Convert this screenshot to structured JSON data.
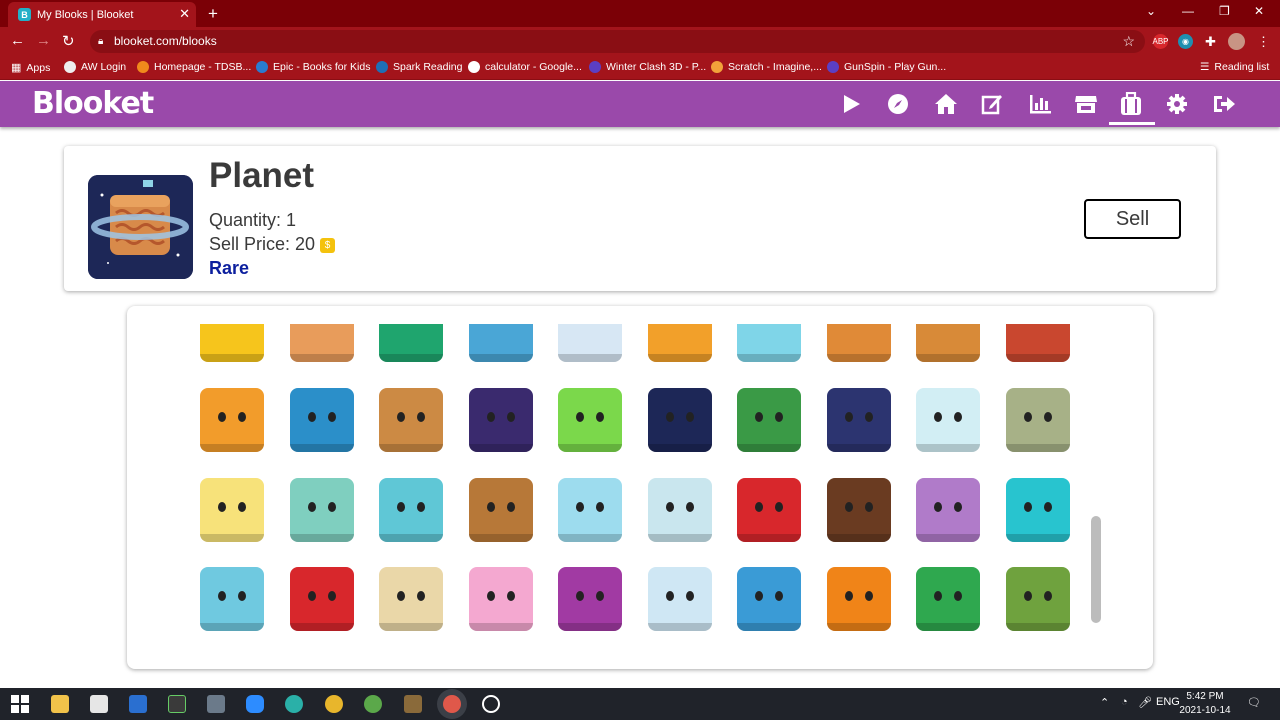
{
  "browser": {
    "tab_title": "My Blooks | Blooket",
    "tab_favicon": "B",
    "url": "blooket.com/blooks",
    "bookmarks": [
      "Apps",
      "AW Login",
      "Homepage - TDSB...",
      "Epic - Books for Kids",
      "Spark Reading",
      "calculator - Google...",
      "Winter Clash 3D - P...",
      "Scratch - Imagine,...",
      "GunSpin - Play Gun..."
    ],
    "reading_list": "Reading list"
  },
  "header": {
    "logo": "Blooket",
    "icons": [
      "play-icon",
      "compass-icon",
      "home-icon",
      "edit-icon",
      "stats-icon",
      "market-icon",
      "blooks-icon",
      "settings-icon",
      "logout-icon"
    ]
  },
  "selected_blook": {
    "name": "Planet",
    "quantity_label": "Quantity: 1",
    "sell_price_label": "Sell Price: 20",
    "rarity": "Rare",
    "sell_button": "Sell"
  },
  "blooks": [
    {
      "name": "sun-blook",
      "color": "#f6c51c"
    },
    {
      "name": "toast-blook",
      "color": "#e89c5b"
    },
    {
      "name": "sushi-blook",
      "color": "#1fa56e"
    },
    {
      "name": "strawberry-milk-blook",
      "color": "#4aa6d6"
    },
    {
      "name": "breakfast-plate-blook",
      "color": "#d7e7f4"
    },
    {
      "name": "orange-juice-blook",
      "color": "#f2a02a"
    },
    {
      "name": "cow-blook",
      "color": "#7fd5e8"
    },
    {
      "name": "waffle-blook",
      "color": "#e08a37"
    },
    {
      "name": "pancakes-blook",
      "color": "#d88a38"
    },
    {
      "name": "pie-blook",
      "color": "#c9472f"
    },
    {
      "name": "pizza-blook",
      "color": "#f29c2b"
    },
    {
      "name": "earth-blook",
      "color": "#2b8fc9"
    },
    {
      "name": "mars-blook",
      "color": "#cc8a44"
    },
    {
      "name": "stars-blook",
      "color": "#3a2a6e"
    },
    {
      "name": "alien-blook",
      "color": "#7bd84b"
    },
    {
      "name": "planet-blook",
      "color": "#1d2757"
    },
    {
      "name": "ufo-blook",
      "color": "#3a9a46"
    },
    {
      "name": "rocket-blook",
      "color": "#2c3470"
    },
    {
      "name": "astronaut-blook",
      "color": "#d2eef4"
    },
    {
      "name": "alarm-bot-blook",
      "color": "#a7b187"
    },
    {
      "name": "lovely-bot-blook",
      "color": "#f7e27a"
    },
    {
      "name": "angry-bot-blook",
      "color": "#7fcfbf"
    },
    {
      "name": "computer-bot-blook",
      "color": "#5fc7d6"
    },
    {
      "name": "wooden-bot-blook",
      "color": "#b77838"
    },
    {
      "name": "mega-bot-blook",
      "color": "#9ddcee"
    },
    {
      "name": "brain-bot-blook",
      "color": "#c9e6ee"
    },
    {
      "name": "red-bot-blook",
      "color": "#d8272c"
    },
    {
      "name": "boot-blook",
      "color": "#6a3b21"
    },
    {
      "name": "jellyfish-blook",
      "color": "#b07bc9"
    },
    {
      "name": "clownfish-blook",
      "color": "#28c4cf"
    },
    {
      "name": "frog-blook",
      "color": "#6fc9e0"
    },
    {
      "name": "crab-blook",
      "color": "#d8272c"
    },
    {
      "name": "pufferfish-blook",
      "color": "#ead7a8"
    },
    {
      "name": "blobfish-blook",
      "color": "#f4a8d0"
    },
    {
      "name": "octopus-blook",
      "color": "#a13aa3"
    },
    {
      "name": "narwhal-blook",
      "color": "#cfe7f4"
    },
    {
      "name": "shark-blook",
      "color": "#3a9bd6"
    },
    {
      "name": "pumpkin-blook",
      "color": "#f08418"
    },
    {
      "name": "swamp-monster-blook",
      "color": "#2fa84f"
    },
    {
      "name": "frankenstein-blook",
      "color": "#6fa23e"
    }
  ],
  "taskbar": {
    "language": "ENG",
    "time": "5:42 PM",
    "date": "2021-10-14"
  }
}
